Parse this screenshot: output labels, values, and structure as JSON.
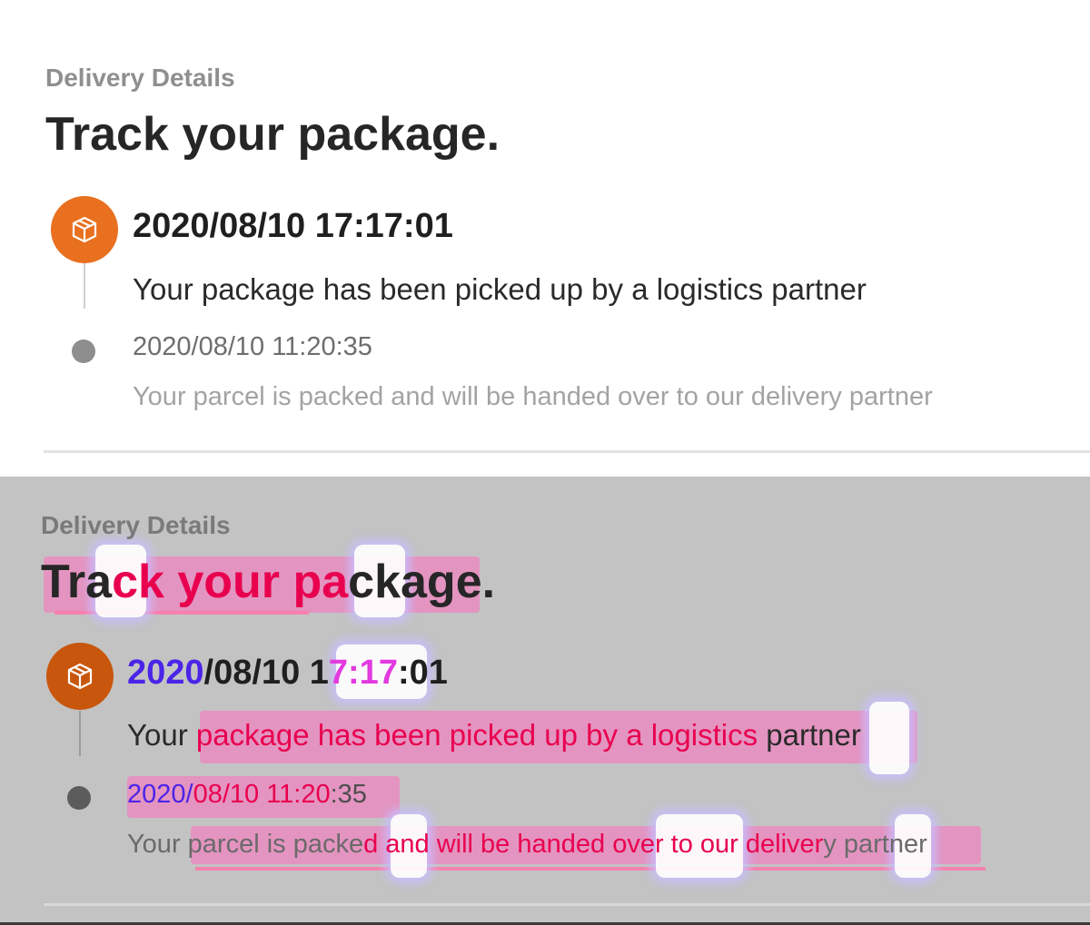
{
  "panels": [
    {
      "eyebrow": "Delivery Details",
      "headline": "Track your package.",
      "events": [
        {
          "timestamp": "2020/08/10 17:17:01",
          "description": "Your package has been picked up by a logistics partner",
          "icon": "package-icon"
        },
        {
          "timestamp": "2020/08/10 11:20:35",
          "description": "Your parcel is packed and will be handed over to our delivery partner",
          "icon": "dot"
        }
      ]
    }
  ],
  "colors": {
    "accent": "#e8701f",
    "overlay_bg": "#c3c3c3",
    "highlight": "#ff6ebe"
  }
}
